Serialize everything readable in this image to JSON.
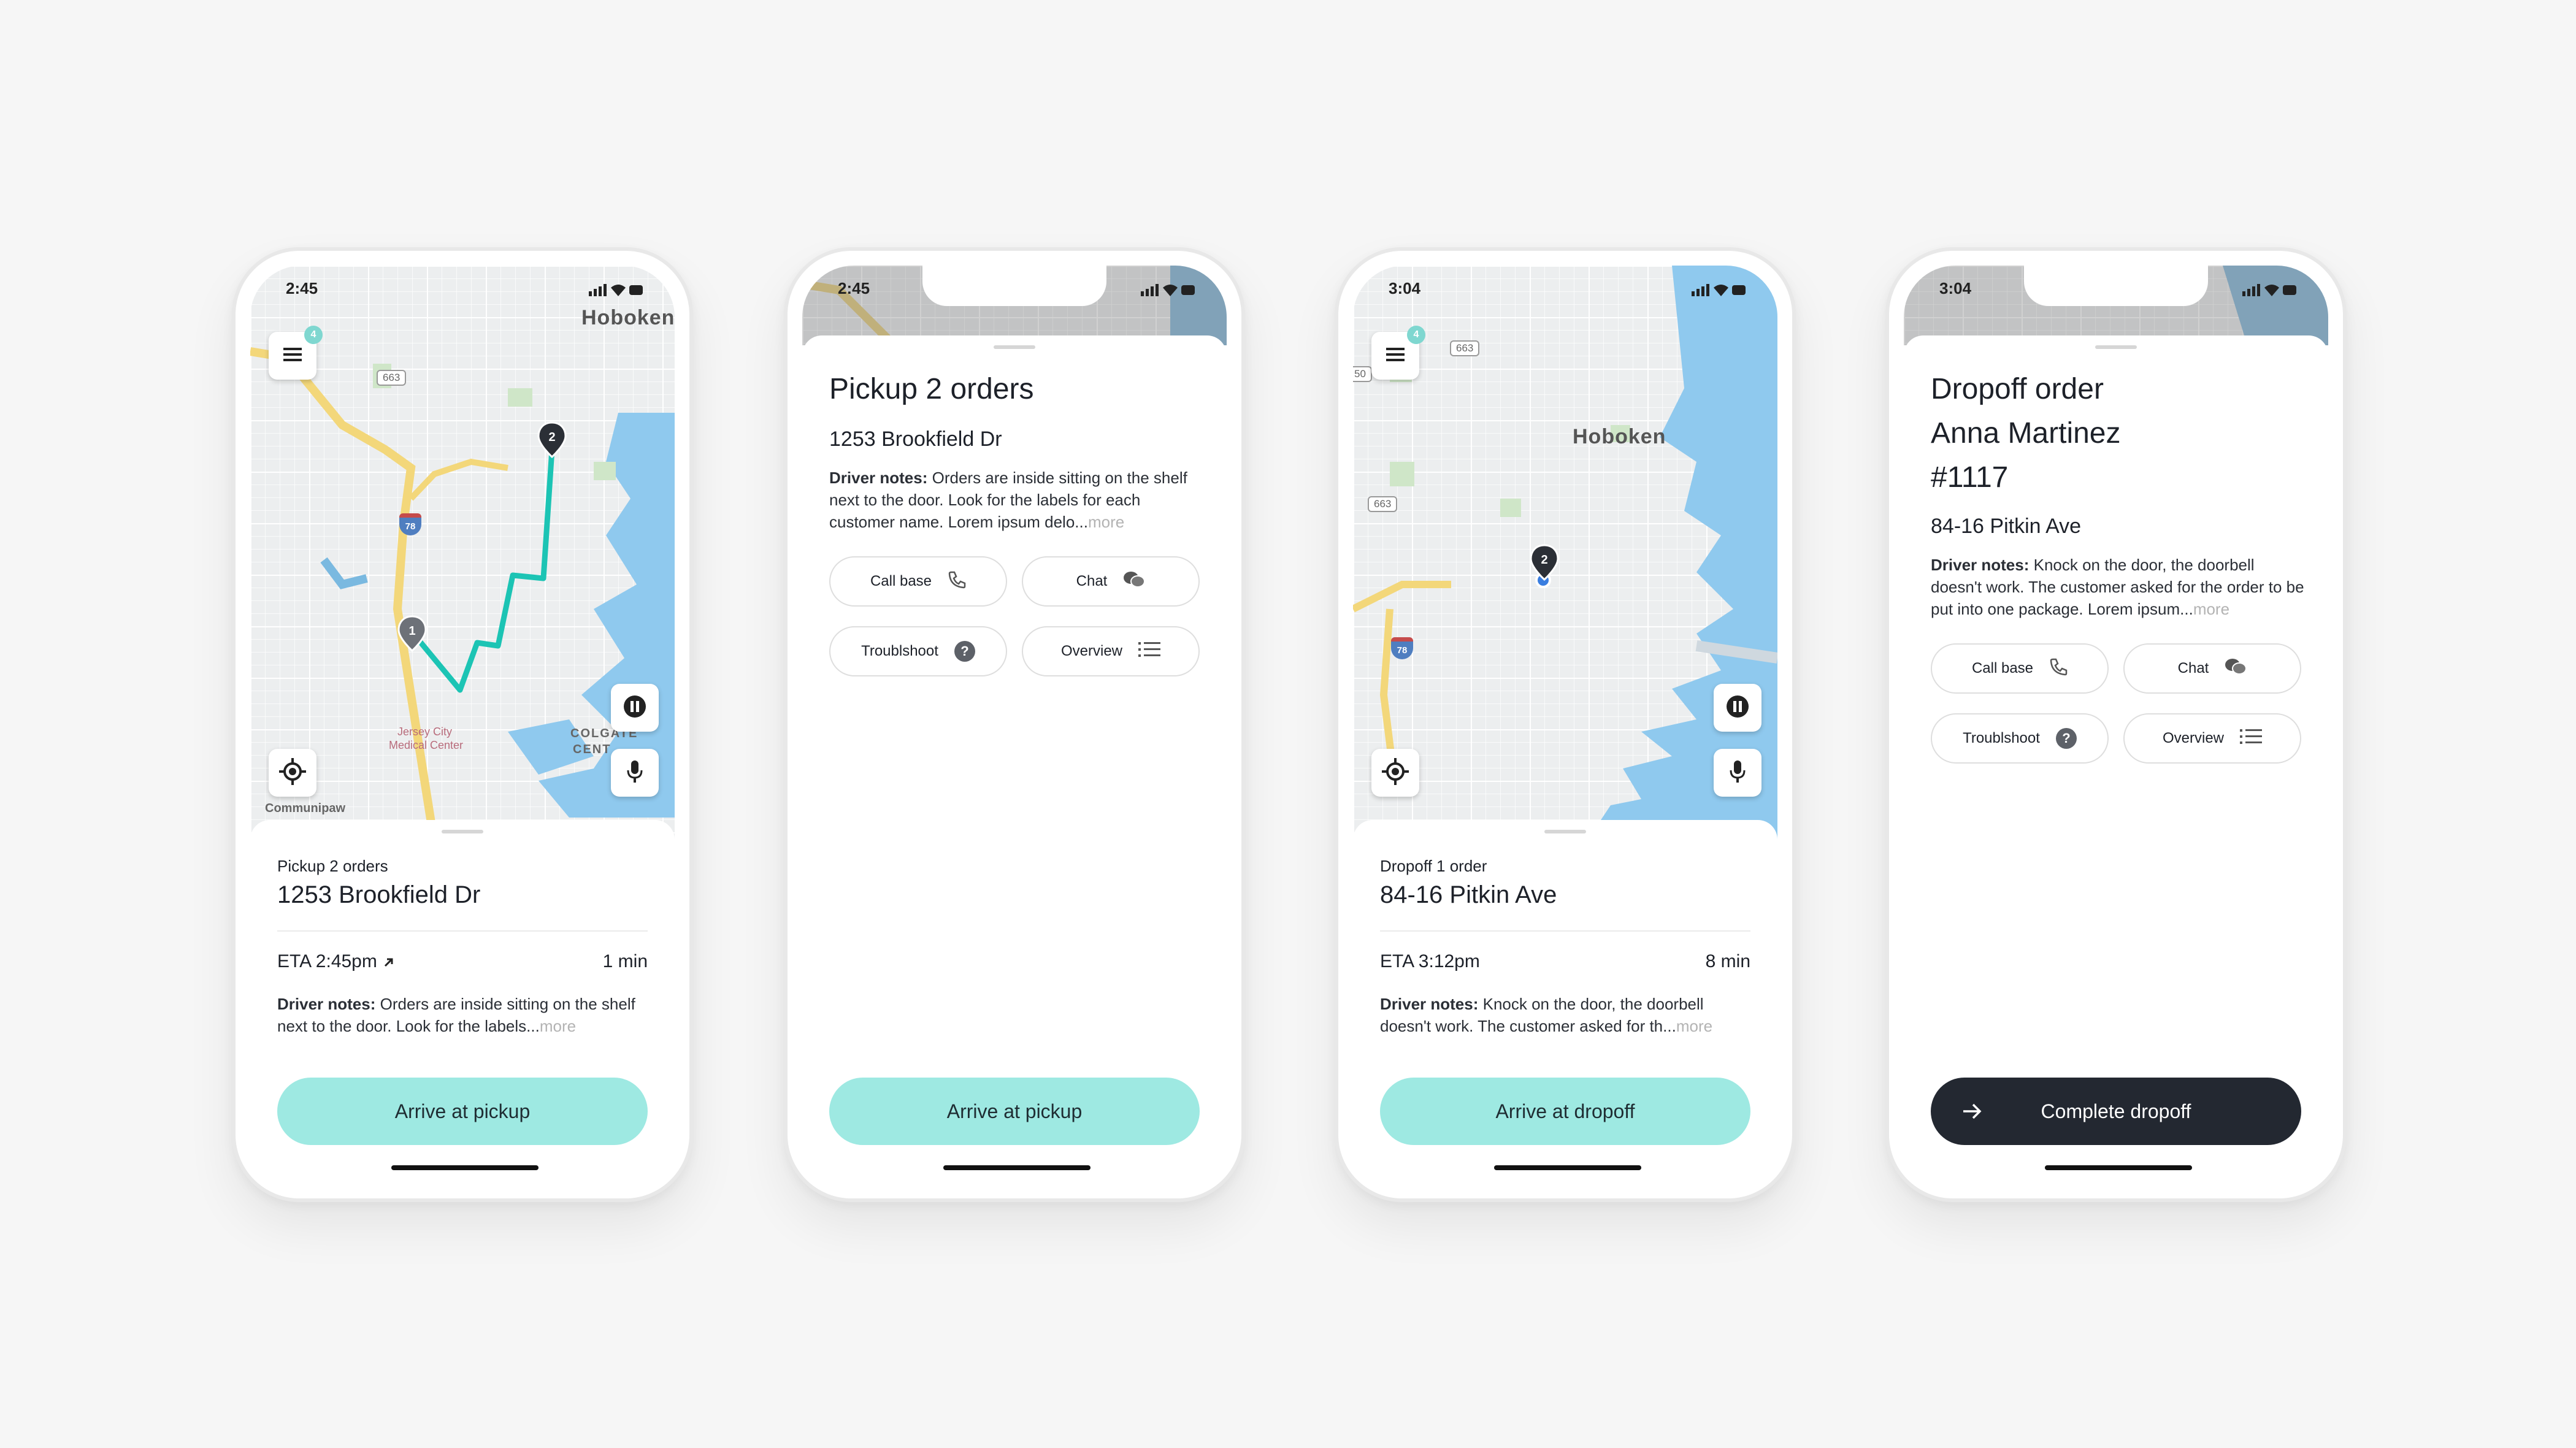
{
  "colors": {
    "background": "#f6f6f6",
    "accent_teal": "#9ee9e2",
    "route_teal": "#1cc4b4",
    "dark_button": "#232831",
    "water": "#8fc9ee",
    "map_base": "#eceeef"
  },
  "phones": [
    {
      "status_time": "2:45",
      "map": {
        "city_label": "Hoboken",
        "badge_count": "4",
        "highway_663": "663",
        "highway_78": "78",
        "hospital_label_1": "Jersey City",
        "hospital_label_2": "Medical Center",
        "area_label_1": "COLGATE",
        "area_label_2": "CENT",
        "bottom_label": "Communipaw",
        "pin_1": "1",
        "pin_2": "2"
      },
      "sheet": {
        "small_label": "Pickup 2 orders",
        "address": "1253 Brookfield Dr",
        "eta": "ETA 2:45pm",
        "minutes": "1 min",
        "notes_label": "Driver notes:",
        "notes_text": " Orders are inside sitting on the shelf next to the door. Look for the labels...",
        "notes_more": "more",
        "button": "Arrive at pickup"
      }
    },
    {
      "status_time": "2:45",
      "detail": {
        "title": "Pickup 2 orders",
        "address": "1253 Brookfield Dr",
        "notes_label": "Driver notes:",
        "notes_text": " Orders are inside sitting on the shelf next to the door. Look for the labels for each customer name. Lorem ipsum delo...",
        "notes_more": "more",
        "chips": {
          "call": "Call base",
          "chat": "Chat",
          "troubleshoot": "Troublshoot",
          "overview": "Overview"
        },
        "button": "Arrive at pickup"
      }
    },
    {
      "status_time": "3:04",
      "map": {
        "city_label": "Hoboken",
        "badge_count": "4",
        "highway_663": "663",
        "highway_663_b": "663",
        "highway_50": "50",
        "highway_78": "78",
        "pin_2": "2"
      },
      "sheet": {
        "small_label": "Dropoff 1 order",
        "address": "84-16 Pitkin Ave",
        "eta": "ETA 3:12pm",
        "minutes": "8 min",
        "notes_label": "Driver notes:",
        "notes_text": " Knock on the door, the doorbell doesn't work. The customer asked for th...",
        "notes_more": "more",
        "button": "Arrive at dropoff"
      }
    },
    {
      "status_time": "3:04",
      "detail": {
        "title_line_1": "Dropoff order",
        "title_line_2": "Anna Martinez",
        "title_line_3": "#1117",
        "address": "84-16 Pitkin Ave",
        "notes_label": "Driver notes:",
        "notes_text": " Knock on the door, the doorbell doesn't work. The customer asked for the order to be put into one package. Lorem ipsum...",
        "notes_more": "more",
        "chips": {
          "call": "Call base",
          "chat": "Chat",
          "troubleshoot": "Troublshoot",
          "overview": "Overview"
        },
        "button": "Complete dropoff"
      }
    }
  ]
}
